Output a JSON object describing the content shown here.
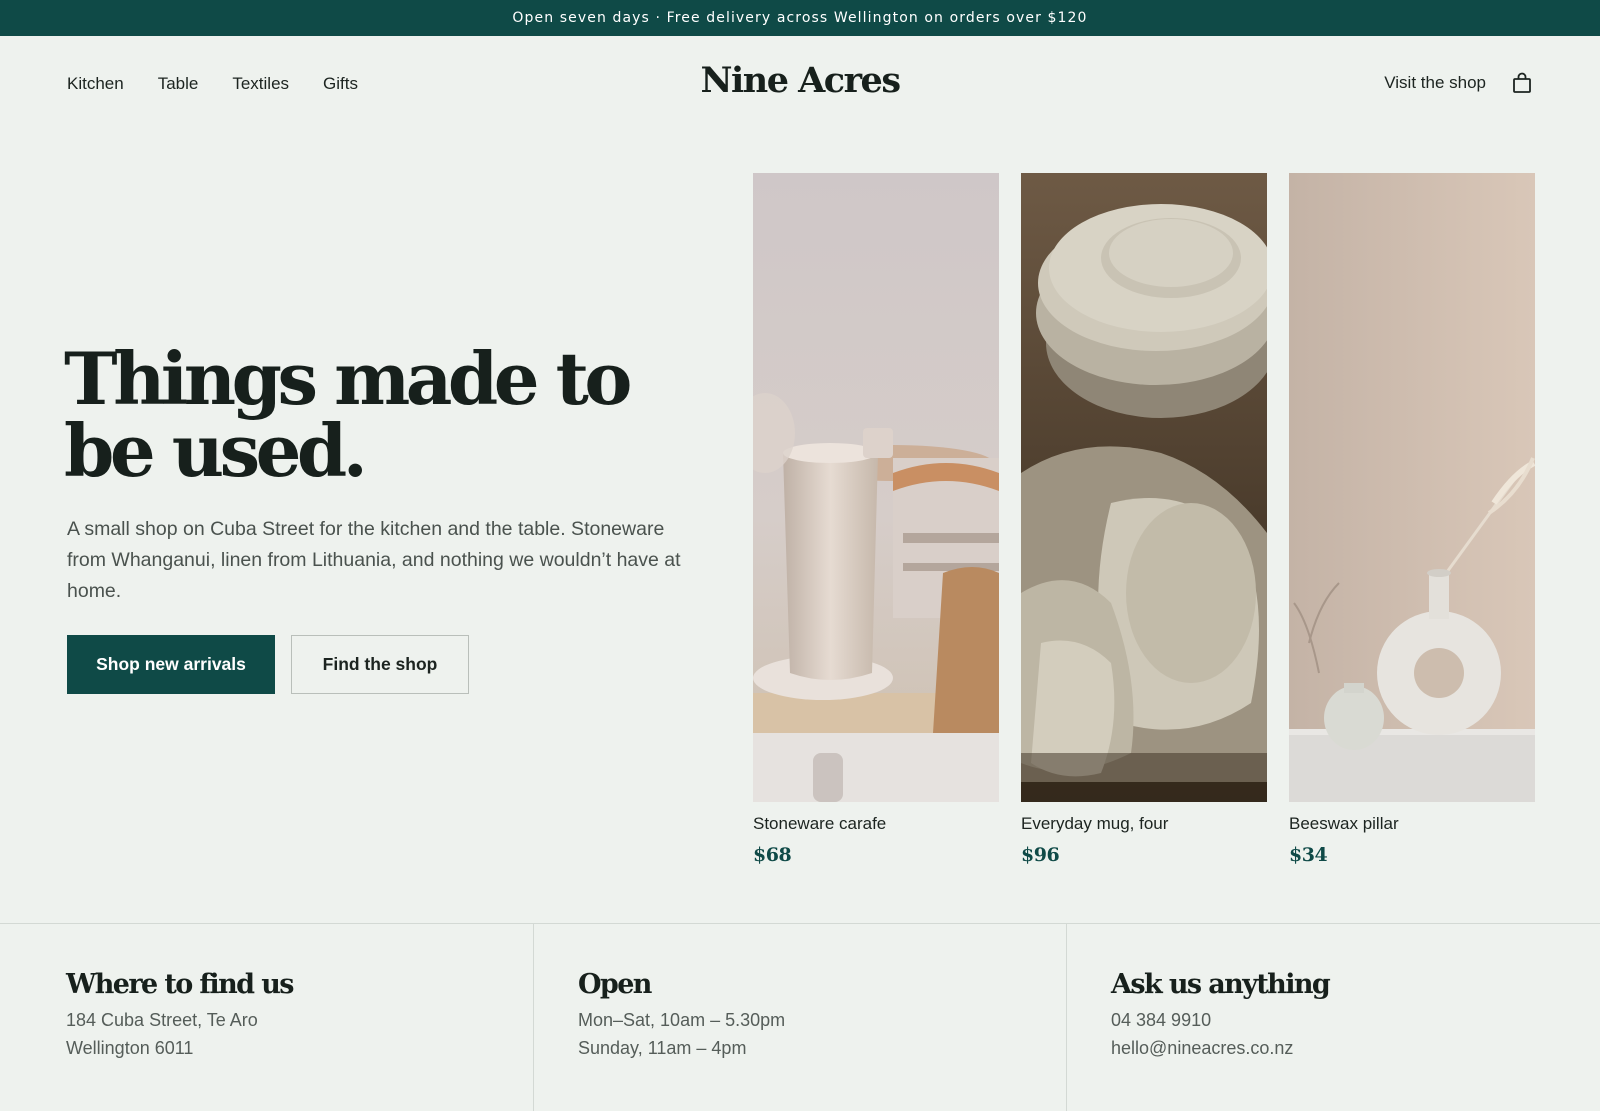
{
  "announcement": "Open seven days · Free delivery across Wellington on orders over $120",
  "nav": {
    "links": [
      "Kitchen",
      "Table",
      "Textiles",
      "Gifts"
    ],
    "logo": "Nine Acres",
    "visit": "Visit the shop",
    "bag_icon": "shopping-bag-icon"
  },
  "hero": {
    "headline": "Things made to be used.",
    "lede": "A small shop on Cuba Street for the kitchen and the table. Stoneware from Whanganui, linen from Lithuania, and nothing we wouldn’t have at home.",
    "primary_cta": "Shop new arrivals",
    "secondary_cta": "Find the shop"
  },
  "products": [
    {
      "name": "Stoneware carafe",
      "price": "$68"
    },
    {
      "name": "Everyday mug, four",
      "price": "$96"
    },
    {
      "name": "Beeswax pillar",
      "price": "$34"
    }
  ],
  "footer": {
    "find": {
      "title": "Where to find us",
      "lines": [
        "184 Cuba Street, Te Aro",
        "Wellington 6011"
      ]
    },
    "open": {
      "title": "Open",
      "lines": [
        "Mon–Sat, 10am – 5.30pm",
        "Sunday, 11am – 4pm"
      ]
    },
    "ask": {
      "title": "Ask us anything",
      "lines": [
        "04 384 9910",
        "hello@nineacres.co.nz"
      ]
    }
  },
  "colors": {
    "brand": "#0f4a47",
    "background": "#eef2ee",
    "text": "#17201c"
  }
}
